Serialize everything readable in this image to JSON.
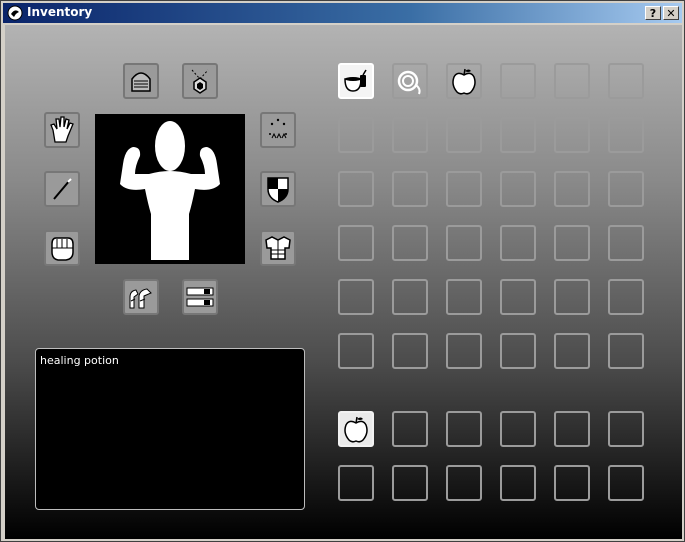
{
  "window": {
    "title": "Inventory",
    "help_button": "?",
    "close_button": "✕"
  },
  "equipment": [
    {
      "slot": "helmet",
      "icon": "helmet-icon"
    },
    {
      "slot": "amulet",
      "icon": "amulet-icon"
    },
    {
      "slot": "gloves",
      "icon": "hand-icon"
    },
    {
      "slot": "magic",
      "icon": "sparkles-icon"
    },
    {
      "slot": "weapon",
      "icon": "wand-icon"
    },
    {
      "slot": "shield",
      "icon": "shield-icon"
    },
    {
      "slot": "fist",
      "icon": "gauntlet-icon"
    },
    {
      "slot": "armor",
      "icon": "armor-icon"
    },
    {
      "slot": "boots",
      "icon": "boots-icon"
    },
    {
      "slot": "belt",
      "icon": "belt-icon"
    }
  ],
  "inventory": {
    "rows": 6,
    "cols": 6,
    "items": [
      {
        "row": 0,
        "col": 0,
        "item": "healing potion",
        "icon": "potion-icon",
        "selected": true
      },
      {
        "row": 0,
        "col": 1,
        "item": "rope",
        "icon": "rope-icon"
      },
      {
        "row": 0,
        "col": 2,
        "item": "apple",
        "icon": "apple-icon"
      }
    ]
  },
  "quickbar": {
    "rows": 2,
    "cols": 6,
    "items": [
      {
        "row": 0,
        "col": 0,
        "item": "apple",
        "icon": "apple-icon"
      }
    ]
  },
  "description": {
    "text": "healing potion"
  },
  "colors": {
    "title_start": "#0a246a",
    "title_end": "#a6caf0",
    "slot_border": "#9b9b9b",
    "panel_bg": "#000000"
  }
}
